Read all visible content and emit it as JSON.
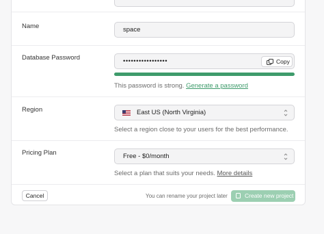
{
  "form": {
    "name": {
      "label": "Name",
      "value": "space"
    },
    "password": {
      "label": "Database Password",
      "value": "•••••••••••••••••",
      "copy_label": "Copy",
      "hint_prefix": "This password is strong.",
      "hint_link": "Generate a password",
      "strength_fraction": 1.0
    },
    "region": {
      "label": "Region",
      "value": "East US (North Virginia)",
      "hint": "Select a region close to your users for the best performance.",
      "flag_icon": "us-flag-icon"
    },
    "plan": {
      "label": "Pricing Plan",
      "value": "Free - $0/month",
      "hint_prefix": "Select a plan that suits your needs.",
      "hint_link": "More details"
    }
  },
  "footer": {
    "cancel_label": "Cancel",
    "note": "You can rename your project later",
    "create_label": "Create new project"
  },
  "colors": {
    "accent": "#3e9b6b",
    "accent_disabled": "#9ccfb2"
  }
}
